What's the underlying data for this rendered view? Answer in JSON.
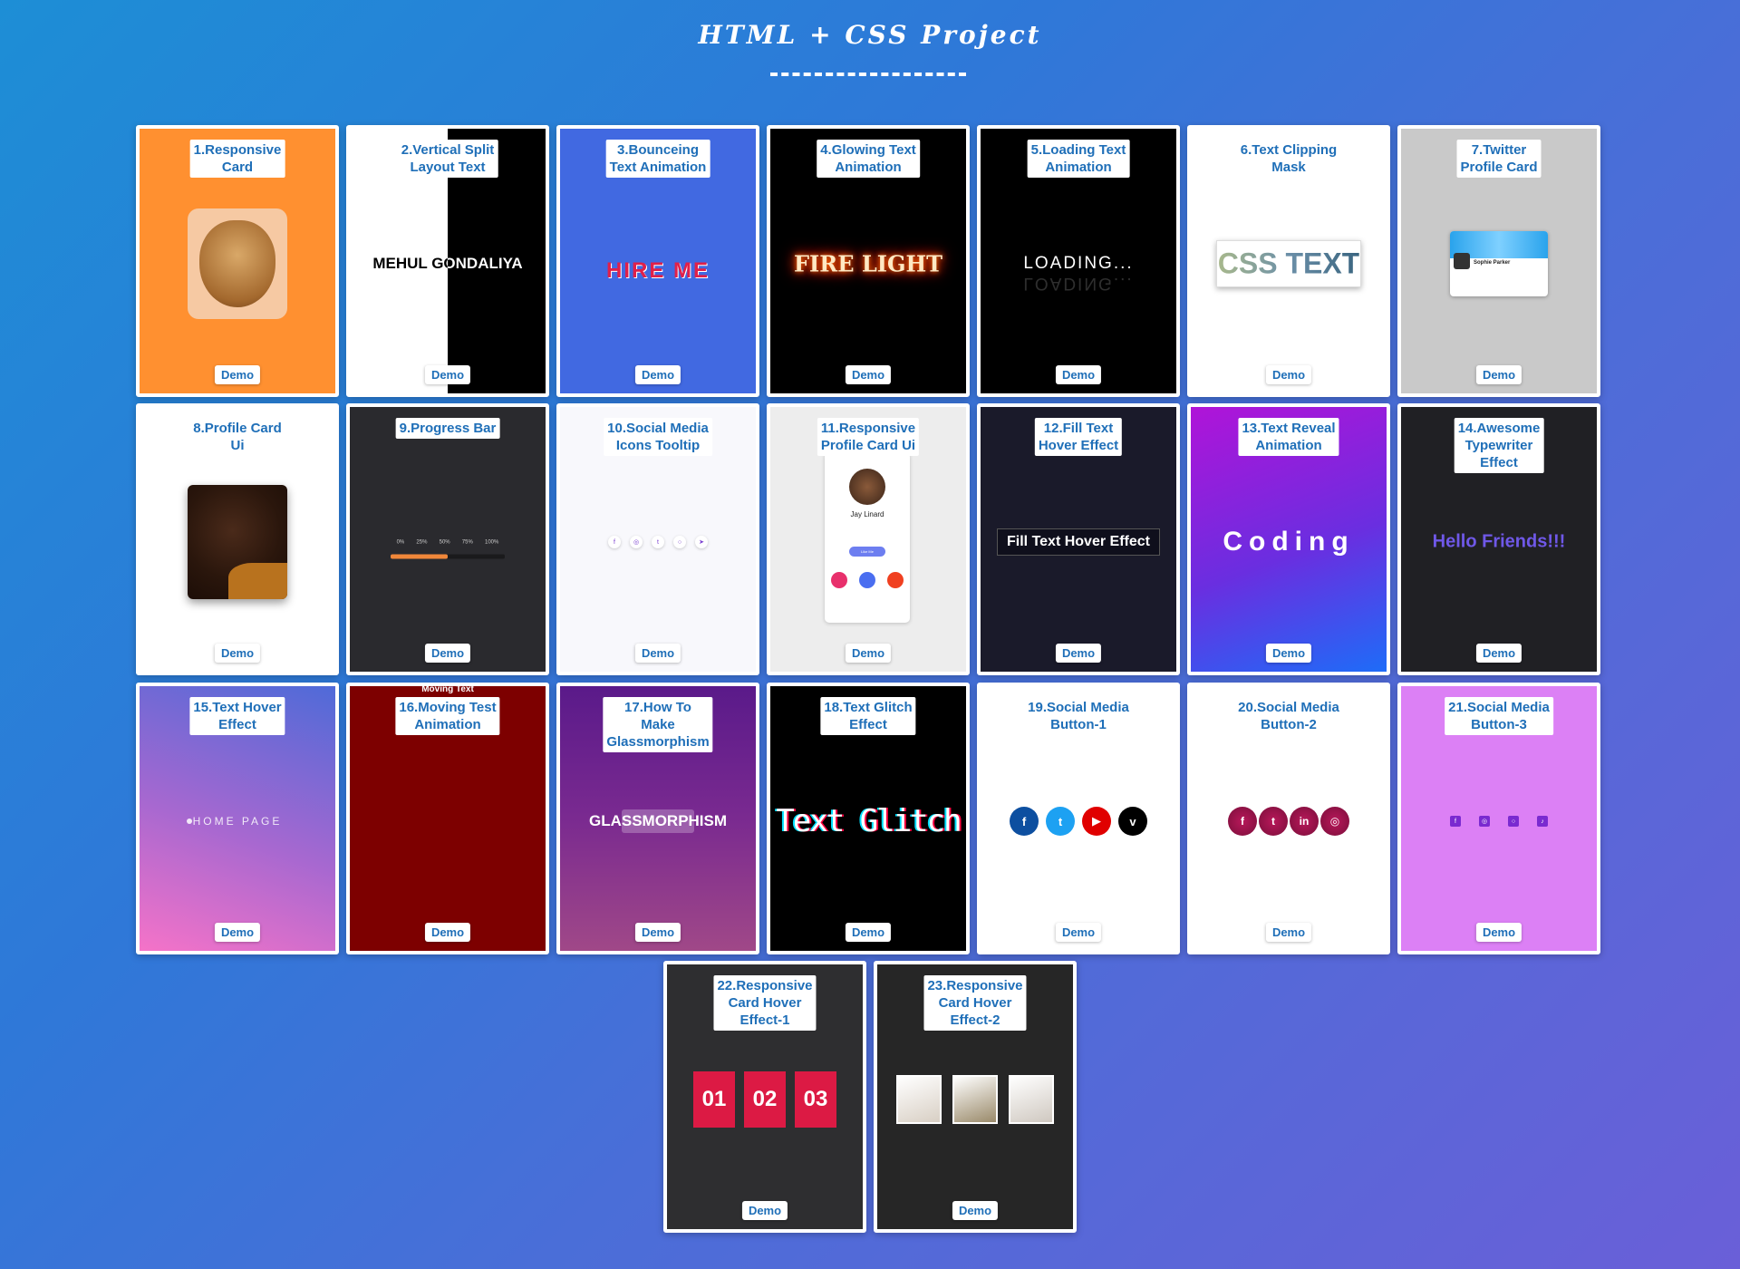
{
  "header": {
    "title": "HTML + CSS Project",
    "underline": "------------"
  },
  "demo_label": "Demo",
  "cards": [
    {
      "label": "1.Responsive\nCard",
      "bg": "#ff9030"
    },
    {
      "label": "2.Vertical Split\nLayout Text",
      "preview_text": "MEHUL GONDALIYA"
    },
    {
      "label": "3.Bounceing\nText Animation",
      "bg": "#4169e1",
      "preview_text": "HIRE ME"
    },
    {
      "label": "4.Glowing Text\nAnimation",
      "bg": "#000000",
      "preview_text": "FIRE LIGHT"
    },
    {
      "label": "5.Loading Text\nAnimation",
      "bg": "#000000",
      "preview_text": "LOADING..."
    },
    {
      "label": "6.Text Clipping\nMask",
      "bg": "#ffffff",
      "preview_text": "CSS TEXT"
    },
    {
      "label": "7.Twitter\nProfile Card",
      "bg": "#c9c9c9",
      "preview_text": "Sophie Parker"
    },
    {
      "label": "8.Profile Card\nUi",
      "bg": "#ffffff"
    },
    {
      "label": "9.Progress Bar",
      "bg": "#2a2a2e",
      "progress_steps": [
        "0%",
        "25%",
        "50%",
        "75%",
        "100%"
      ],
      "progress_value": 0.5
    },
    {
      "label": "10.Social Media\nIcons Tooltip",
      "bg": "#f8f8fc"
    },
    {
      "label": "11.Responsive\nProfile Card Ui",
      "bg": "#ededed",
      "preview_text": "Jay Linard",
      "preview_button": "Like Me"
    },
    {
      "label": "12.Fill Text\nHover Effect",
      "bg": "#1a1a2a",
      "preview_text": "Fill Text Hover Effect"
    },
    {
      "label": "13.Text Reveal\nAnimation",
      "preview_text": "Coding"
    },
    {
      "label": "14.Awesome\nTypewriter\nEffect",
      "bg": "#202024",
      "preview_text": "Hello Friends!!!"
    },
    {
      "label": "15.Text Hover\nEffect",
      "preview_text": "HOME PAGE"
    },
    {
      "label": "16.Moving Test\nAnimation",
      "bg": "#7d0000",
      "preview_text": "Moving Text"
    },
    {
      "label": "17.How To\nMake\nGlassmorphism",
      "preview_text": "GLASSMORPHISM"
    },
    {
      "label": "18.Text Glitch\nEffect",
      "bg": "#000000",
      "preview_text": "Text Glitch"
    },
    {
      "label": "19.Social Media\nButton-1",
      "bg": "#ffffff"
    },
    {
      "label": "20.Social Media\nButton-2",
      "bg": "#ffffff"
    },
    {
      "label": "21.Social Media\nButton-3",
      "bg": "#dc80f5"
    },
    {
      "label": "22.Responsive\nCard Hover\nEffect-1",
      "bg": "#2e2e30",
      "preview_items": [
        "01",
        "02",
        "03"
      ]
    },
    {
      "label": "23.Responsive\nCard Hover\nEffect-2",
      "bg": "#262626"
    }
  ]
}
